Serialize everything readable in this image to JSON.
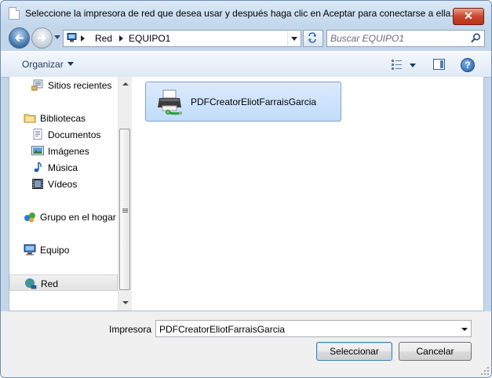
{
  "window": {
    "title": "Seleccione la impresora de red que desea usar y después haga clic en Aceptar para conectarse a ella.",
    "close_label": "✕"
  },
  "address_bar": {
    "breadcrumb": [
      "Red",
      "EQUIPO1"
    ],
    "search_placeholder": "Buscar EQUIPO1"
  },
  "toolbar": {
    "organize_label": "Organizar",
    "help_label": "?"
  },
  "nav_pane": {
    "items": [
      {
        "label": "Sitios recientes",
        "icon": "recent-places-icon"
      },
      {
        "label": "Bibliotecas",
        "icon": "libraries-icon"
      },
      {
        "label": "Documentos",
        "icon": "documents-icon"
      },
      {
        "label": "Imágenes",
        "icon": "pictures-icon"
      },
      {
        "label": "Música",
        "icon": "music-icon"
      },
      {
        "label": "Vídeos",
        "icon": "videos-icon"
      },
      {
        "label": "Grupo en el hogar",
        "icon": "homegroup-icon"
      },
      {
        "label": "Equipo",
        "icon": "computer-icon"
      },
      {
        "label": "Red",
        "icon": "network-icon",
        "selected": true
      }
    ]
  },
  "file_pane": {
    "items": [
      {
        "label": "PDFCreatorEliotFarraisGarcia",
        "icon": "printer-icon",
        "selected": true
      }
    ]
  },
  "bottom": {
    "printer_label": "Impresora",
    "printer_value": "PDFCreatorEliotFarraisGarcia",
    "select_button": "Seleccionar",
    "cancel_button": "Cancelar"
  }
}
